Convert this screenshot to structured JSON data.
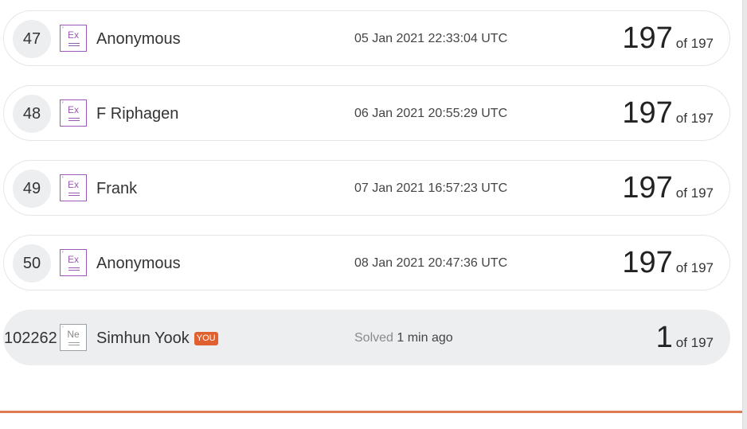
{
  "rows": [
    {
      "rank": "47",
      "level_icon": "ex-level-icon",
      "level_symbol": "Ex",
      "name": "Anonymous",
      "date": "05 Jan 2021 22:33:04 UTC",
      "score": "197",
      "of_text": "of 197"
    },
    {
      "rank": "48",
      "level_icon": "ex-level-icon",
      "level_symbol": "Ex",
      "name": "F Riphagen",
      "date": "06 Jan 2021 20:55:29 UTC",
      "score": "197",
      "of_text": "of 197"
    },
    {
      "rank": "49",
      "level_icon": "ex-level-icon",
      "level_symbol": "Ex",
      "name": "Frank",
      "date": "07 Jan 2021 16:57:23 UTC",
      "score": "197",
      "of_text": "of 197"
    },
    {
      "rank": "50",
      "level_icon": "ex-level-icon",
      "level_symbol": "Ex",
      "name": "Anonymous",
      "date": "08 Jan 2021 20:47:36 UTC",
      "score": "197",
      "of_text": "of 197"
    }
  ],
  "current_user": {
    "rank": "102262",
    "level_icon": "ne-level-icon",
    "level_symbol": "Ne",
    "name": "Simhun Yook",
    "badge": "YOU",
    "solved_label": "Solved",
    "solved_time": "1 min ago",
    "score": "1",
    "of_text": "of 197"
  },
  "colors": {
    "accent": "#e0612f",
    "ex_level": "#9b59b6",
    "row_highlight": "#eceef0"
  }
}
